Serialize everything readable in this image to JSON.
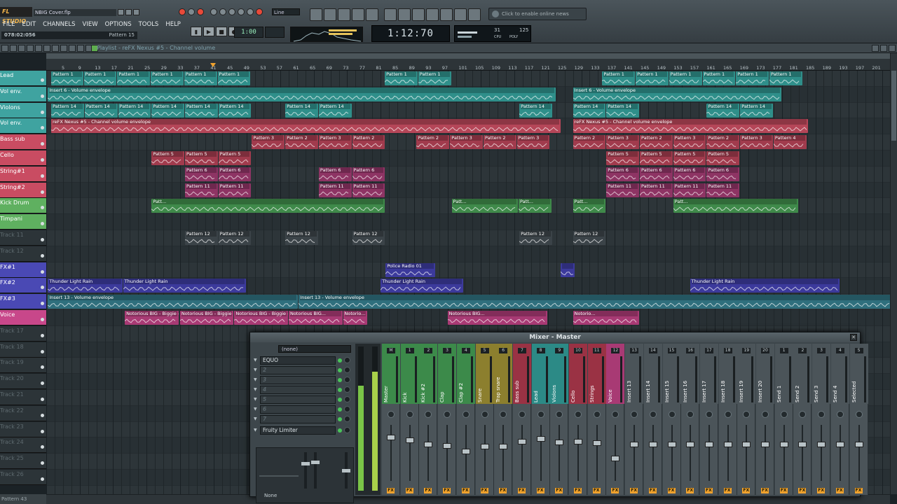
{
  "app": {
    "logo": "FL STUDIO",
    "project_file": "NBIG Cover.flp",
    "menus": [
      "FILE",
      "EDIT",
      "CHANNELS",
      "VIEW",
      "OPTIONS",
      "TOOLS",
      "HELP"
    ],
    "hint_left": "078:02:056",
    "hint_right": "Pattern 15",
    "snap_mode": "Line",
    "tempo_display": "1:00",
    "clock": "1:12:70",
    "cpu_values": [
      "31",
      "125",
      "CPU",
      "POLY"
    ],
    "news_text": "Click to enable online news",
    "icons": {
      "logo": "fruit-logo-icon",
      "news": "globe-icon"
    }
  },
  "playlist": {
    "title": "Playlist - reFX Nexus #5 - Channel volume",
    "bars": [
      "5",
      "9",
      "13",
      "17",
      "21",
      "25",
      "29",
      "33",
      "37",
      "41",
      "45",
      "49",
      "53",
      "57",
      "61",
      "65",
      "69",
      "73",
      "77",
      "81",
      "85",
      "89",
      "93",
      "97",
      "101",
      "105",
      "109",
      "113",
      "117",
      "121",
      "125",
      "129",
      "133",
      "137",
      "141",
      "145",
      "149",
      "153",
      "157",
      "161",
      "165",
      "169",
      "173",
      "177",
      "181",
      "185",
      "189",
      "193",
      "197",
      "201"
    ],
    "playhead_bar": "41",
    "tracks": [
      {
        "name": "Lead",
        "color": "#3fa3a0"
      },
      {
        "name": "Vol env.",
        "color": "#3fa3a0"
      },
      {
        "name": "Violons",
        "color": "#3fa3a0"
      },
      {
        "name": "Vol env.",
        "color": "#3fa3a0"
      },
      {
        "name": "Bass sub",
        "color": "#c94c62"
      },
      {
        "name": "Cello",
        "color": "#c94c62"
      },
      {
        "name": "String#1",
        "color": "#c94c62"
      },
      {
        "name": "String#2",
        "color": "#c94c62"
      },
      {
        "name": "Kick Drum",
        "color": "#5fb060"
      },
      {
        "name": "Timpani",
        "color": "#5fb060"
      },
      {
        "name": "Track 11",
        "color": ""
      },
      {
        "name": "Track 12",
        "color": ""
      },
      {
        "name": "FX#1",
        "color": "#4a49b4"
      },
      {
        "name": "FX#2",
        "color": "#4a49b4"
      },
      {
        "name": "FX#3",
        "color": "#4a49b4"
      },
      {
        "name": "Voice",
        "color": "#c8478a"
      },
      {
        "name": "Track 17",
        "color": ""
      },
      {
        "name": "Track 18",
        "color": ""
      },
      {
        "name": "Track 19",
        "color": ""
      },
      {
        "name": "Track 20",
        "color": ""
      },
      {
        "name": "Track 21",
        "color": ""
      },
      {
        "name": "Track 22",
        "color": ""
      },
      {
        "name": "Track 23",
        "color": ""
      },
      {
        "name": "Track 24",
        "color": ""
      },
      {
        "name": "Track 25",
        "color": ""
      },
      {
        "name": "Track 26",
        "color": ""
      }
    ],
    "clips": [
      {
        "row": 0,
        "start": 0.6,
        "len": 3.9,
        "label": "Pattern 1",
        "color": "#2f8f8a"
      },
      {
        "row": 0,
        "start": 4.5,
        "len": 4.0,
        "label": "Pattern 1",
        "color": "#2f8f8a"
      },
      {
        "row": 0,
        "start": 8.5,
        "len": 4.0,
        "label": "Pattern 1",
        "color": "#2f8f8a"
      },
      {
        "row": 0,
        "start": 12.5,
        "len": 4.0,
        "label": "Pattern 1",
        "color": "#2f8f8a"
      },
      {
        "row": 0,
        "start": 16.5,
        "len": 4.0,
        "label": "Pattern 1",
        "color": "#2f8f8a"
      },
      {
        "row": 0,
        "start": 20.5,
        "len": 4.0,
        "label": "Pattern 1",
        "color": "#2f8f8a"
      },
      {
        "row": 0,
        "start": 40.5,
        "len": 4.0,
        "label": "Pattern 1",
        "color": "#2f8f8a"
      },
      {
        "row": 0,
        "start": 44.5,
        "len": 4.0,
        "label": "Pattern 1",
        "color": "#2f8f8a"
      },
      {
        "row": 0,
        "start": 66.5,
        "len": 4.0,
        "label": "Pattern 1",
        "color": "#2f8f8a"
      },
      {
        "row": 0,
        "start": 70.5,
        "len": 4.0,
        "label": "Pattern 1",
        "color": "#2f8f8a"
      },
      {
        "row": 0,
        "start": 74.5,
        "len": 4.0,
        "label": "Pattern 1",
        "color": "#2f8f8a"
      },
      {
        "row": 0,
        "start": 78.5,
        "len": 4.0,
        "label": "Pattern 1",
        "color": "#2f8f8a"
      },
      {
        "row": 0,
        "start": 82.5,
        "len": 4.0,
        "label": "Pattern 1",
        "color": "#2f8f8a"
      },
      {
        "row": 0,
        "start": 86.5,
        "len": 4.0,
        "label": "Pattern 1",
        "color": "#2f8f8a"
      },
      {
        "row": 1,
        "start": 0.2,
        "len": 60.8,
        "label": "Insert 6 - Volume envelope",
        "color": "#2f8f8a"
      },
      {
        "row": 1,
        "start": 63.0,
        "len": 25.0,
        "label": "Insert 6 - Volume envelope",
        "color": "#2f8f8a"
      },
      {
        "row": 2,
        "start": 0.6,
        "len": 4.0,
        "label": "Pattern 14",
        "color": "#2f8f8a"
      },
      {
        "row": 2,
        "start": 4.6,
        "len": 4.0,
        "label": "Pattern 14",
        "color": "#2f8f8a"
      },
      {
        "row": 2,
        "start": 8.6,
        "len": 4.0,
        "label": "Pattern 14",
        "color": "#2f8f8a"
      },
      {
        "row": 2,
        "start": 12.6,
        "len": 4.0,
        "label": "Pattern 14",
        "color": "#2f8f8a"
      },
      {
        "row": 2,
        "start": 16.6,
        "len": 4.0,
        "label": "Pattern 14",
        "color": "#2f8f8a"
      },
      {
        "row": 2,
        "start": 20.6,
        "len": 4.0,
        "label": "Pattern 14",
        "color": "#2f8f8a"
      },
      {
        "row": 2,
        "start": 28.6,
        "len": 4.0,
        "label": "Pattern 14",
        "color": "#2f8f8a"
      },
      {
        "row": 2,
        "start": 32.6,
        "len": 4.0,
        "label": "Pattern 14",
        "color": "#2f8f8a"
      },
      {
        "row": 2,
        "start": 56.6,
        "len": 4.0,
        "label": "Pattern 14",
        "color": "#2f8f8a"
      },
      {
        "row": 2,
        "start": 63.0,
        "len": 4.0,
        "label": "Pattern 14",
        "color": "#2f8f8a"
      },
      {
        "row": 2,
        "start": 67.0,
        "len": 4.0,
        "label": "Pattern 14",
        "color": "#2f8f8a"
      },
      {
        "row": 2,
        "start": 79.0,
        "len": 4.0,
        "label": "Pattern 14",
        "color": "#2f8f8a"
      },
      {
        "row": 2,
        "start": 83.0,
        "len": 4.0,
        "label": "Pattern 14",
        "color": "#2f8f8a"
      },
      {
        "row": 3,
        "start": 0.6,
        "len": 61.0,
        "label": "reFX Nexus #5 - Channel volume envelope",
        "color": "#b54658"
      },
      {
        "row": 3,
        "start": 63.0,
        "len": 28.2,
        "label": "reFX Nexus #5 - Channel volume envelope",
        "color": "#b54658"
      },
      {
        "row": 4,
        "start": 24.6,
        "len": 4.0,
        "label": "Pattern 3",
        "color": "#a13b4d"
      },
      {
        "row": 4,
        "start": 28.6,
        "len": 4.0,
        "label": "Pattern 2",
        "color": "#a13b4d"
      },
      {
        "row": 4,
        "start": 32.6,
        "len": 4.0,
        "label": "Pattern 3",
        "color": "#a13b4d"
      },
      {
        "row": 4,
        "start": 36.6,
        "len": 4.0,
        "label": "Pattern 2",
        "color": "#a13b4d"
      },
      {
        "row": 4,
        "start": 44.3,
        "len": 4.0,
        "label": "Pattern 2",
        "color": "#a13b4d"
      },
      {
        "row": 4,
        "start": 48.3,
        "len": 4.0,
        "label": "Pattern 3",
        "color": "#a13b4d"
      },
      {
        "row": 4,
        "start": 52.3,
        "len": 4.0,
        "label": "Pattern 2",
        "color": "#a13b4d"
      },
      {
        "row": 4,
        "start": 56.3,
        "len": 4.0,
        "label": "Pattern 3",
        "color": "#a13b4d"
      },
      {
        "row": 4,
        "start": 63.0,
        "len": 4.0,
        "label": "Pattern 2",
        "color": "#a13b4d"
      },
      {
        "row": 4,
        "start": 67.0,
        "len": 4.0,
        "label": "Pattern 3",
        "color": "#a13b4d"
      },
      {
        "row": 4,
        "start": 71.0,
        "len": 4.0,
        "label": "Pattern 2",
        "color": "#a13b4d"
      },
      {
        "row": 4,
        "start": 75.0,
        "len": 4.0,
        "label": "Pattern 3",
        "color": "#a13b4d"
      },
      {
        "row": 4,
        "start": 79.0,
        "len": 4.0,
        "label": "Pattern 2",
        "color": "#a13b4d"
      },
      {
        "row": 4,
        "start": 83.0,
        "len": 4.0,
        "label": "Pattern 3",
        "color": "#a13b4d"
      },
      {
        "row": 4,
        "start": 87.0,
        "len": 4.0,
        "label": "Pattern 4",
        "color": "#a13b4d"
      },
      {
        "row": 5,
        "start": 12.6,
        "len": 4.0,
        "label": "Pattern 5",
        "color": "#a13b4d"
      },
      {
        "row": 5,
        "start": 16.6,
        "len": 4.0,
        "label": "Pattern 5",
        "color": "#a13b4d"
      },
      {
        "row": 5,
        "start": 20.6,
        "len": 4.0,
        "label": "Pattern 5",
        "color": "#a13b4d"
      },
      {
        "row": 5,
        "start": 67.0,
        "len": 4.0,
        "label": "Pattern 5",
        "color": "#a13b4d"
      },
      {
        "row": 5,
        "start": 71.0,
        "len": 4.0,
        "label": "Pattern 5",
        "color": "#a13b4d"
      },
      {
        "row": 5,
        "start": 75.0,
        "len": 4.0,
        "label": "Pattern 5",
        "color": "#a13b4d"
      },
      {
        "row": 5,
        "start": 79.0,
        "len": 4.0,
        "label": "Pattern 5",
        "color": "#a13b4d"
      },
      {
        "row": 6,
        "start": 16.6,
        "len": 4.0,
        "label": "Pattern 6",
        "color": "#8e3464"
      },
      {
        "row": 6,
        "start": 20.6,
        "len": 4.0,
        "label": "Pattern 6",
        "color": "#8e3464"
      },
      {
        "row": 6,
        "start": 32.6,
        "len": 4.0,
        "label": "Pattern 6",
        "color": "#8e3464"
      },
      {
        "row": 6,
        "start": 36.6,
        "len": 4.0,
        "label": "Pattern 6",
        "color": "#8e3464"
      },
      {
        "row": 6,
        "start": 67.0,
        "len": 4.0,
        "label": "Pattern 6",
        "color": "#8e3464"
      },
      {
        "row": 6,
        "start": 71.0,
        "len": 4.0,
        "label": "Pattern 6",
        "color": "#8e3464"
      },
      {
        "row": 6,
        "start": 75.0,
        "len": 4.0,
        "label": "Pattern 6",
        "color": "#8e3464"
      },
      {
        "row": 6,
        "start": 79.0,
        "len": 4.0,
        "label": "Pattern 6",
        "color": "#8e3464"
      },
      {
        "row": 7,
        "start": 16.6,
        "len": 4.0,
        "label": "Pattern 11",
        "color": "#8e3464"
      },
      {
        "row": 7,
        "start": 20.6,
        "len": 4.0,
        "label": "Pattern 11",
        "color": "#8e3464"
      },
      {
        "row": 7,
        "start": 32.6,
        "len": 4.0,
        "label": "Pattern 11",
        "color": "#8e3464"
      },
      {
        "row": 7,
        "start": 36.6,
        "len": 4.0,
        "label": "Pattern 11",
        "color": "#8e3464"
      },
      {
        "row": 7,
        "start": 67.0,
        "len": 4.0,
        "label": "Pattern 11",
        "color": "#8e3464"
      },
      {
        "row": 7,
        "start": 71.0,
        "len": 4.0,
        "label": "Pattern 11",
        "color": "#8e3464"
      },
      {
        "row": 7,
        "start": 75.0,
        "len": 4.0,
        "label": "Pattern 11",
        "color": "#8e3464"
      },
      {
        "row": 7,
        "start": 79.0,
        "len": 4.0,
        "label": "Pattern 11",
        "color": "#8e3464"
      },
      {
        "row": 8,
        "start": 12.6,
        "len": 28.0,
        "label": "Patt...",
        "color": "#3f8a4a"
      },
      {
        "row": 8,
        "start": 48.5,
        "len": 8.0,
        "label": "Patt...",
        "color": "#3f8a4a"
      },
      {
        "row": 8,
        "start": 56.5,
        "len": 4.0,
        "label": "Patt...",
        "color": "#3f8a4a"
      },
      {
        "row": 8,
        "start": 63.0,
        "len": 4.0,
        "label": "Patt...",
        "color": "#3f8a4a"
      },
      {
        "row": 8,
        "start": 75.0,
        "len": 15.0,
        "label": "Patt...",
        "color": "#3f8a4a"
      },
      {
        "row": 10,
        "start": 16.6,
        "len": 4.0,
        "label": "Pattern 12",
        "color": "#3b4348"
      },
      {
        "row": 10,
        "start": 20.6,
        "len": 4.0,
        "label": "Pattern 12",
        "color": "#3b4348"
      },
      {
        "row": 10,
        "start": 28.6,
        "len": 4.0,
        "label": "Pattern 12",
        "color": "#3b4348"
      },
      {
        "row": 10,
        "start": 36.6,
        "len": 4.0,
        "label": "Pattern 12",
        "color": "#3b4348"
      },
      {
        "row": 10,
        "start": 56.6,
        "len": 4.0,
        "label": "Pattern 12",
        "color": "#3b4348"
      },
      {
        "row": 10,
        "start": 63.0,
        "len": 4.0,
        "label": "Pattern 12",
        "color": "#3b4348"
      },
      {
        "row": 12,
        "start": 40.6,
        "len": 6.0,
        "label": "Police Radio 01",
        "color": "#3c3a9c"
      },
      {
        "row": 12,
        "start": 61.5,
        "len": 1.8,
        "label": "",
        "color": "#3c3a9c"
      },
      {
        "row": 13,
        "start": 0.2,
        "len": 9.0,
        "label": "Thunder Light Rain",
        "color": "#3c3a9c"
      },
      {
        "row": 13,
        "start": 9.2,
        "len": 14.8,
        "label": "Thunder Light Rain",
        "color": "#3c3a9c"
      },
      {
        "row": 13,
        "start": 40.0,
        "len": 10.0,
        "label": "Thunder Light Rain",
        "color": "#3c3a9c"
      },
      {
        "row": 13,
        "start": 77.0,
        "len": 18.0,
        "label": "Thunder Light Rain",
        "color": "#3c3a9c"
      },
      {
        "row": 14,
        "start": 0.2,
        "len": 30.0,
        "label": "Insert 13 - Volume envelope",
        "color": "#2f6f7d"
      },
      {
        "row": 14,
        "start": 30.2,
        "len": 71.0,
        "label": "Insert 13 - Volume envelope",
        "color": "#2f6f7d"
      },
      {
        "row": 15,
        "start": 9.4,
        "len": 6.5,
        "label": "Notorious BIG - Biggie - Dead Wro...",
        "color": "#a83a74"
      },
      {
        "row": 15,
        "start": 16.0,
        "len": 6.5,
        "label": "Notorious BIG - Biggie - Dea...",
        "color": "#a83a74"
      },
      {
        "row": 15,
        "start": 22.5,
        "len": 6.5,
        "label": "Notorious BIG - Biggie - Dea...",
        "color": "#a83a74"
      },
      {
        "row": 15,
        "start": 29.0,
        "len": 6.5,
        "label": "Notorious BIG...",
        "color": "#a83a74"
      },
      {
        "row": 15,
        "start": 35.5,
        "len": 3.0,
        "label": "Notorio...",
        "color": "#a83a74"
      },
      {
        "row": 15,
        "start": 48.0,
        "len": 12.0,
        "label": "Notorious BIG...",
        "color": "#a83a74"
      },
      {
        "row": 15,
        "start": 63.0,
        "len": 8.0,
        "label": "Notorio...",
        "color": "#a83a74"
      }
    ]
  },
  "mixer": {
    "title": "Mixer - Master",
    "input": "(none)",
    "slots": [
      "EQUO",
      "2",
      "3",
      "4",
      "5",
      "6",
      "7",
      "Fruity Limiter"
    ],
    "eq_preset": "None",
    "channels": [
      {
        "num": "M",
        "label": "Master",
        "color": "#3c8a4a"
      },
      {
        "num": "1",
        "label": "Kick",
        "color": "#3c8a4a"
      },
      {
        "num": "2",
        "label": "Kick #2",
        "color": "#3c8a4a"
      },
      {
        "num": "3",
        "label": "Clap",
        "color": "#3c8a4a"
      },
      {
        "num": "4",
        "label": "Clap #2",
        "color": "#3c8a4a"
      },
      {
        "num": "5",
        "label": "Snare",
        "color": "#8c7f2e"
      },
      {
        "num": "6",
        "label": "Trap snare",
        "color": "#8c7f2e"
      },
      {
        "num": "7",
        "label": "Bass sub",
        "color": "#9a3244"
      },
      {
        "num": "8",
        "label": "Lead",
        "color": "#2c8a86"
      },
      {
        "num": "9",
        "label": "Violons",
        "color": "#2c8a86"
      },
      {
        "num": "10",
        "label": "Cello",
        "color": "#9a3244"
      },
      {
        "num": "11",
        "label": "Strings",
        "color": "#9a3244"
      },
      {
        "num": "12",
        "label": "Voice",
        "color": "#a83a74"
      },
      {
        "num": "13",
        "label": "Insert 13",
        "color": "#4b5459"
      },
      {
        "num": "14",
        "label": "Insert 14",
        "color": "#4b5459"
      },
      {
        "num": "15",
        "label": "Insert 15",
        "color": "#4b5459"
      },
      {
        "num": "16",
        "label": "Insert 16",
        "color": "#4b5459"
      },
      {
        "num": "17",
        "label": "Insert 17",
        "color": "#4b5459"
      },
      {
        "num": "18",
        "label": "Insert 18",
        "color": "#4b5459"
      },
      {
        "num": "19",
        "label": "Insert 19",
        "color": "#4b5459"
      },
      {
        "num": "20",
        "label": "Insert 20",
        "color": "#4b5459"
      },
      {
        "num": "1",
        "label": "Send 1",
        "color": "#4b5459"
      },
      {
        "num": "2",
        "label": "Send 2",
        "color": "#4b5459"
      },
      {
        "num": "3",
        "label": "Send 3",
        "color": "#4b5459"
      },
      {
        "num": "4",
        "label": "Send 4",
        "color": "#4b5459"
      },
      {
        "num": "S",
        "label": "Selected",
        "color": "#4b5459"
      }
    ],
    "fader_levels": [
      0.82,
      0.78,
      0.7,
      0.68,
      0.58,
      0.66,
      0.66,
      0.75,
      0.8,
      0.74,
      0.75,
      0.72,
      0.45,
      0.7,
      0.7,
      0.7,
      0.7,
      0.7,
      0.7,
      0.7,
      0.7,
      0.7,
      0.7,
      0.7,
      0.7,
      0.7
    ]
  },
  "status": {
    "bottom_left": "Pattern 43"
  }
}
